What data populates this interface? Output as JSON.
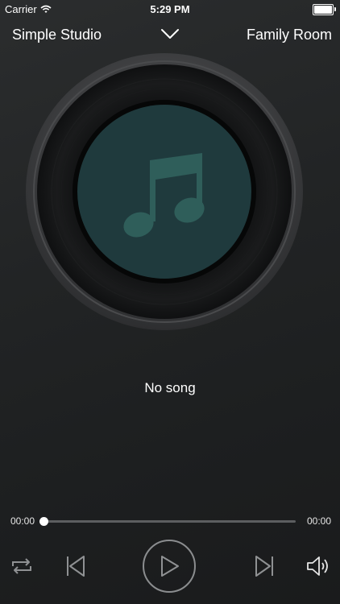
{
  "status_bar": {
    "carrier": "Carrier",
    "time": "5:29 PM",
    "icons": [
      "wifi-icon",
      "battery-icon"
    ]
  },
  "nav": {
    "left_label": "Simple Studio",
    "right_label": "Family Room",
    "center_icon": "chevron-down-icon"
  },
  "artwork": {
    "icon": "music-note-icon",
    "colors": {
      "record": "#121314",
      "label": "#1f3a3d",
      "note": "#2f5e5a"
    }
  },
  "now_playing": {
    "title": "No song"
  },
  "progress": {
    "current_time": "00:00",
    "total_time": "00:00",
    "fraction": 0
  },
  "controls": {
    "icons": [
      "repeat-icon",
      "previous-icon",
      "play-icon",
      "next-icon",
      "volume-icon"
    ]
  }
}
